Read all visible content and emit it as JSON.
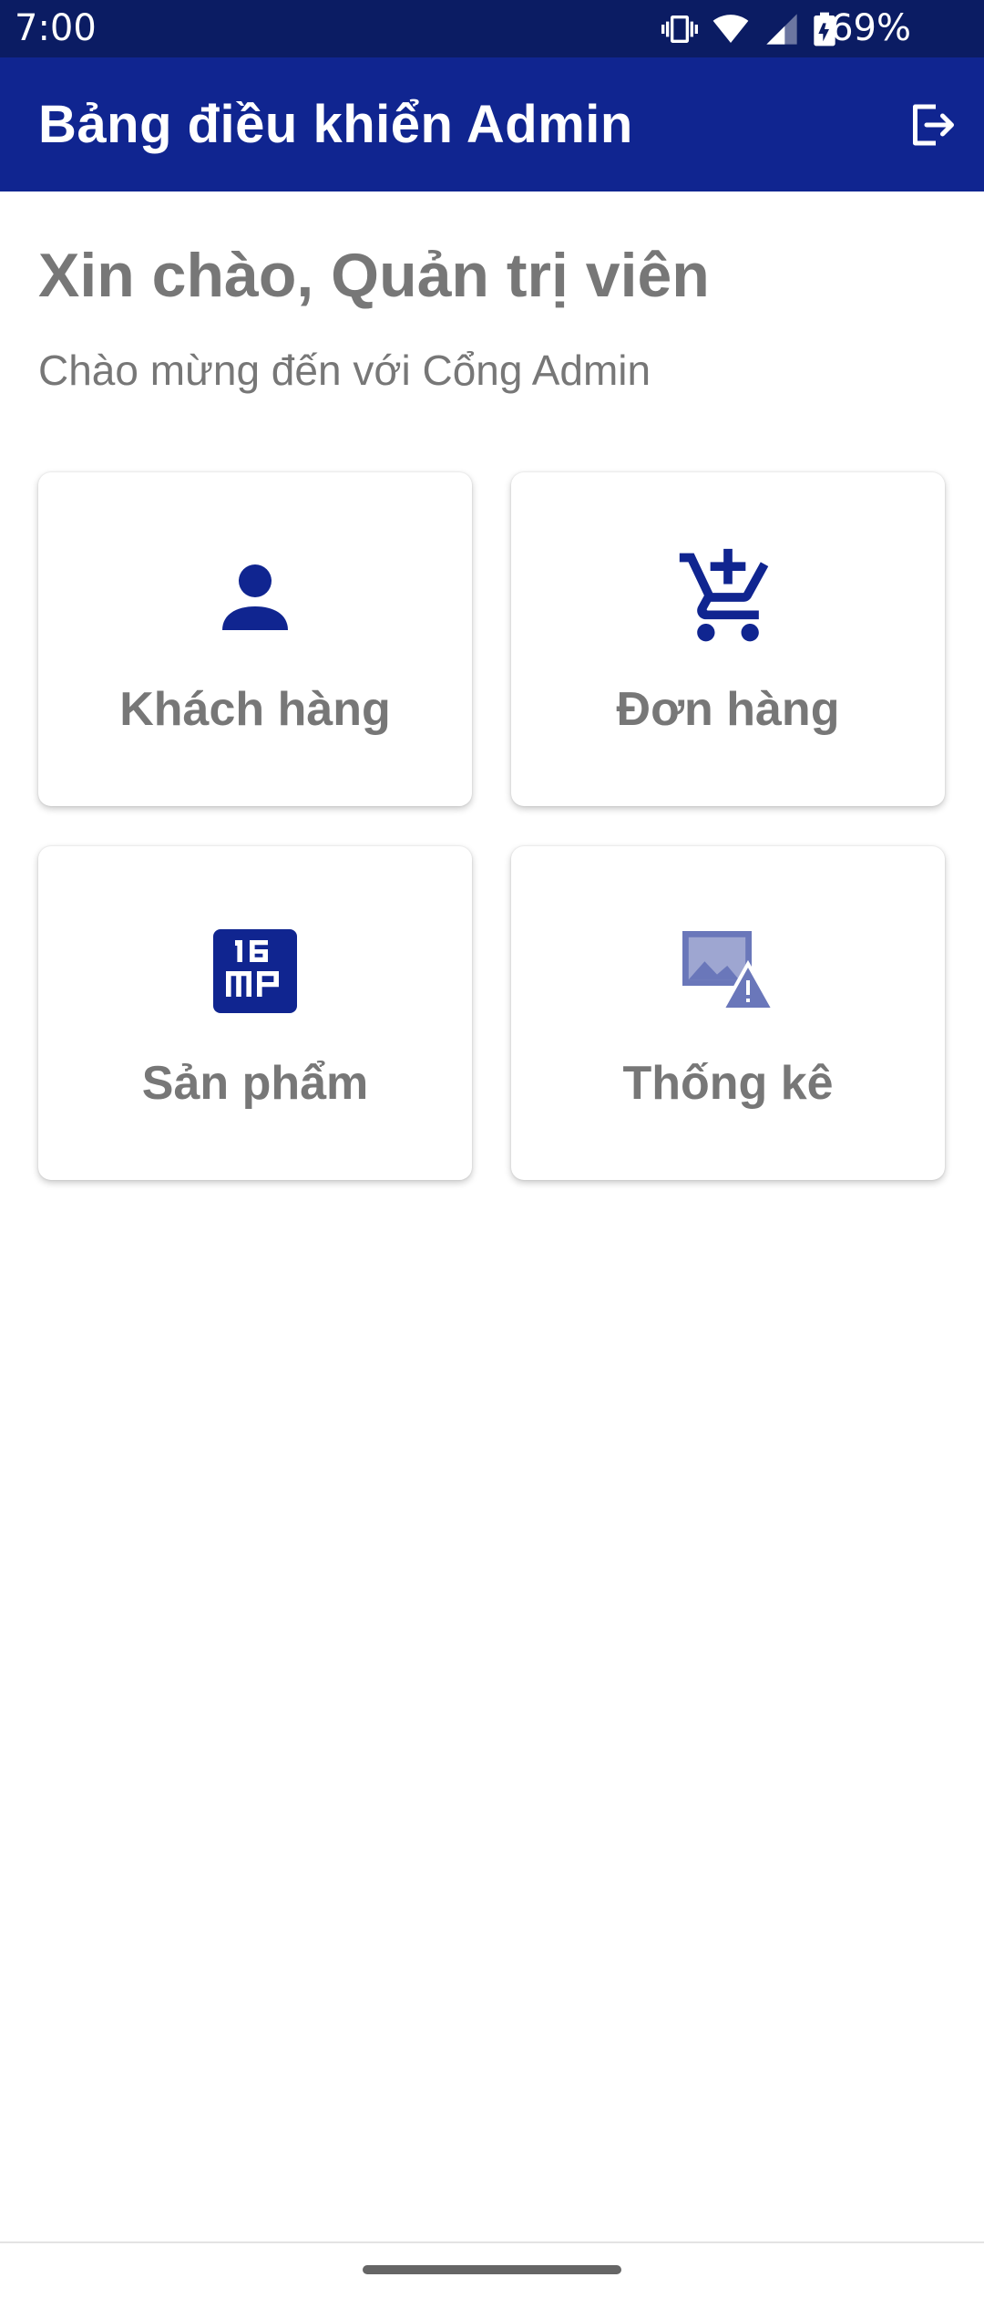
{
  "status_bar": {
    "time": "7:00",
    "battery_percent": "69%",
    "icons": [
      "vibrate-icon",
      "wifi-icon",
      "signal-icon",
      "battery-icon"
    ]
  },
  "app_bar": {
    "title": "Bảng điều khiển Admin",
    "action_icon": "logout-icon"
  },
  "greeting": {
    "title": "Xin chào, Quản trị viên",
    "subtitle": "Chào mừng đến với Cổng Admin"
  },
  "cards": [
    {
      "label": "Khách hàng",
      "icon": "person-icon"
    },
    {
      "label": "Đơn hàng",
      "icon": "add-shopping-cart-icon"
    },
    {
      "label": "Sản phẩm",
      "icon": "16mp-icon"
    },
    {
      "label": "Thống kê",
      "icon": "broken-image-icon"
    }
  ],
  "colors": {
    "status_bar": "#0b1c63",
    "app_bar": "#102590",
    "icon": "#102590",
    "text_muted": "#777777"
  }
}
